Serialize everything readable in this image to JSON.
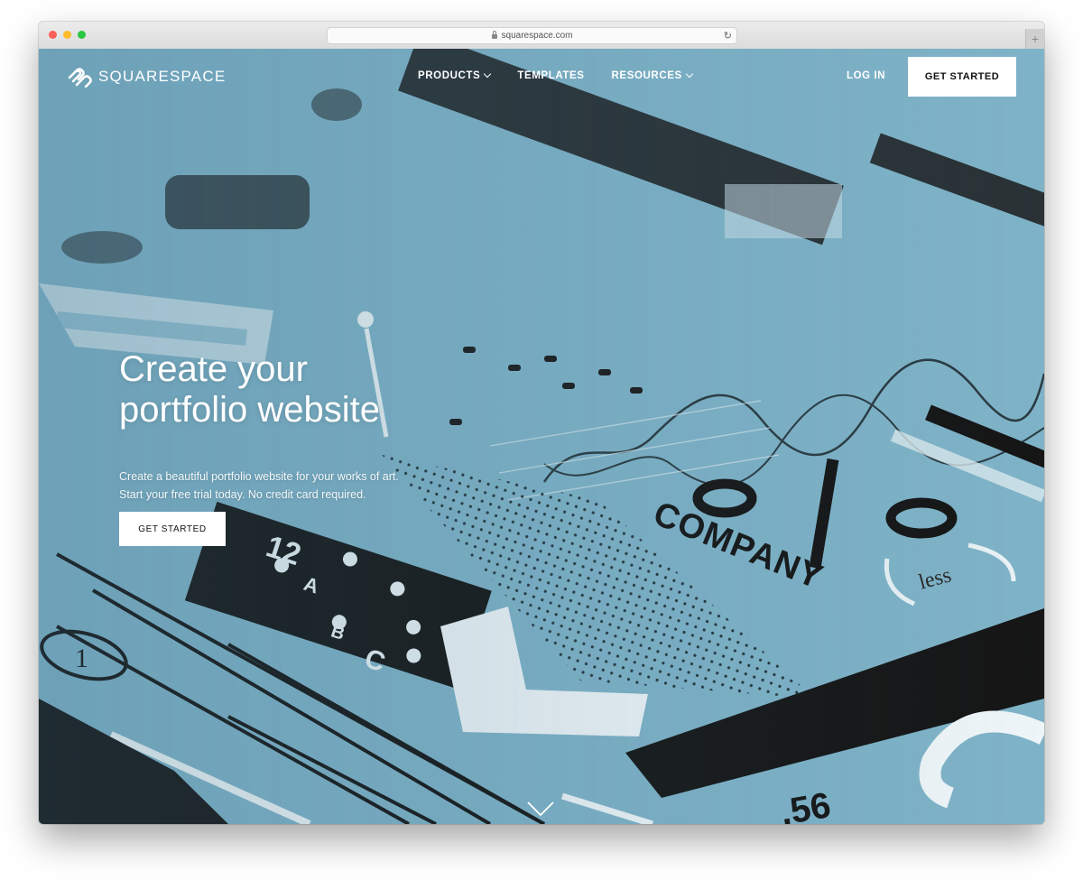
{
  "browser": {
    "url": "squarespace.com"
  },
  "nav": {
    "logo_text": "SQUARESPACE",
    "items": [
      {
        "label": "PRODUCTS",
        "has_dropdown": true
      },
      {
        "label": "TEMPLATES",
        "has_dropdown": false
      },
      {
        "label": "RESOURCES",
        "has_dropdown": true
      }
    ],
    "login_label": "LOG IN",
    "cta_label": "GET STARTED"
  },
  "hero": {
    "headline_line1": "Create your",
    "headline_line2": "portfolio website",
    "subtext_line1": "Create a beautiful portfolio website for your works of art.",
    "subtext_line2": "Start your free trial today. No credit card required.",
    "cta_label": "GET STARTED",
    "background_art_text": {
      "company": "COMPANY",
      "less": "less",
      "numbers": ".56",
      "letters": [
        "A",
        "B",
        "C"
      ],
      "circle_number": "1",
      "digits": "12"
    }
  },
  "icons": {
    "logo": "squarespace-logo-icon",
    "scroll": "chevron-down-icon"
  },
  "colors": {
    "hero_bg": "#7fb3c8",
    "ink": "#1c1c1c",
    "white": "#ffffff"
  }
}
